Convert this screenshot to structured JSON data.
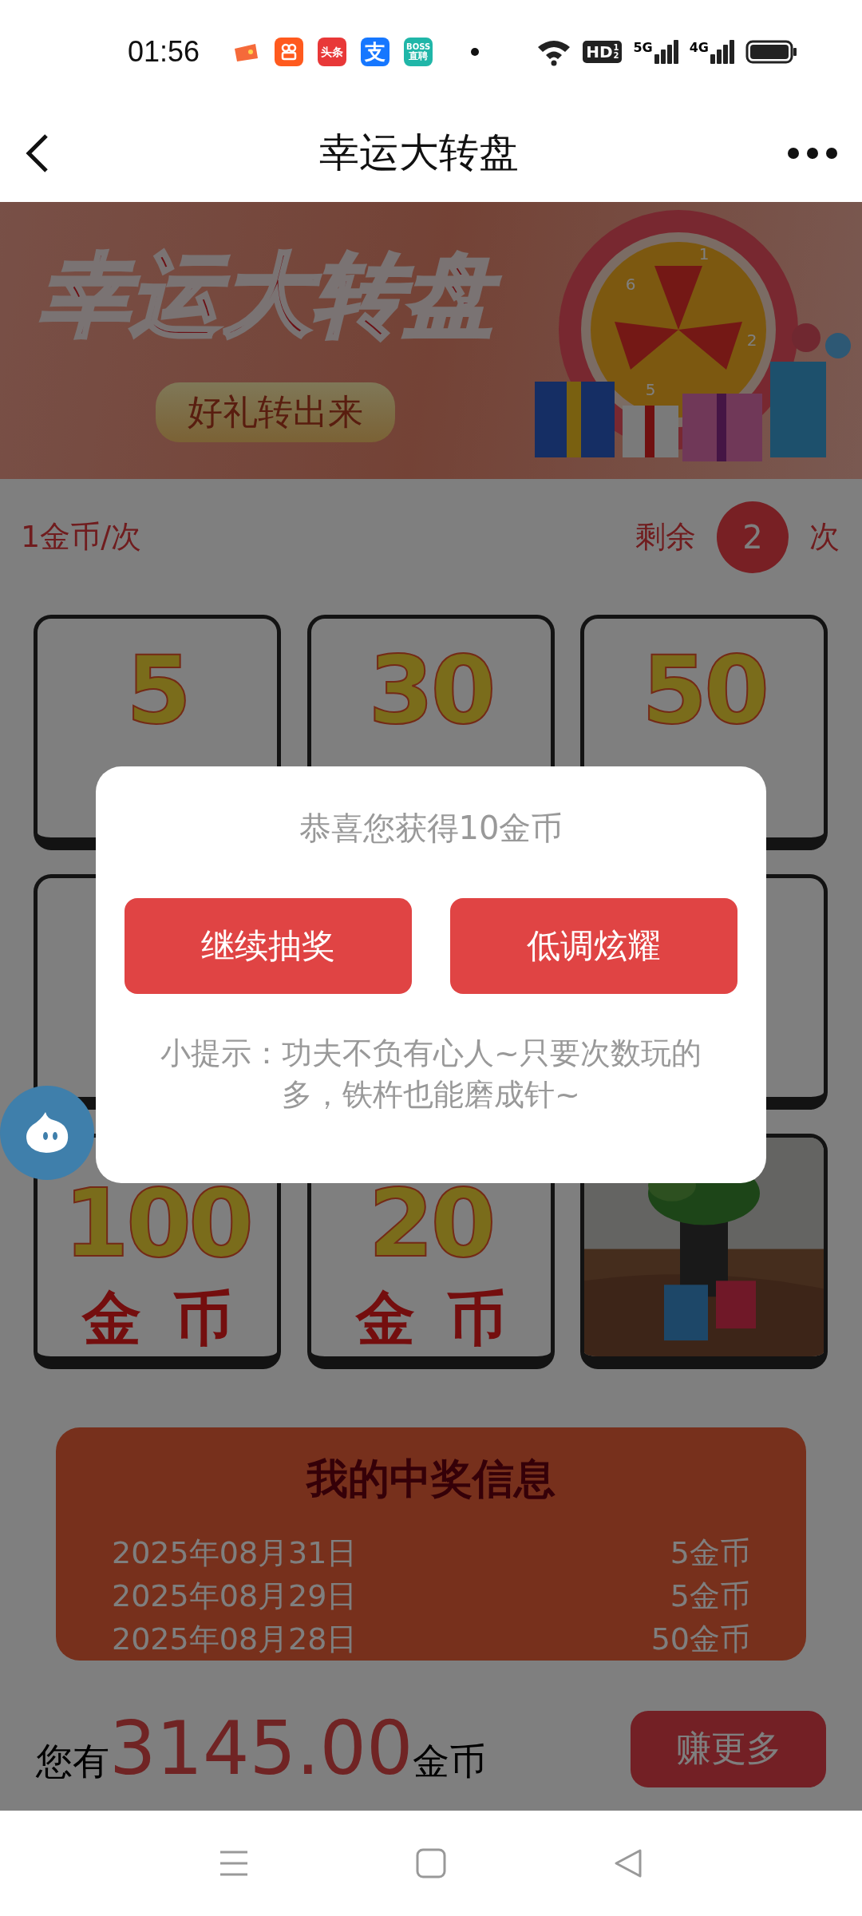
{
  "status_bar": {
    "time": "01:56",
    "app_icons": [
      {
        "kind": "game"
      },
      {
        "kind": "video"
      },
      {
        "kind": "news",
        "label": "头条"
      },
      {
        "kind": "pay",
        "label": "支"
      },
      {
        "kind": "jobs",
        "label": "BOSS",
        "sublabel": "直聘"
      }
    ],
    "hd": "HD",
    "hd_sub": [
      "1",
      "2"
    ],
    "signals": [
      "5G",
      "4G"
    ]
  },
  "nav": {
    "title": "幸运大转盘"
  },
  "banner": {
    "title": "幸运大转盘",
    "slogan": "好礼转出来",
    "wheel_labels": [
      "1",
      "2",
      "5",
      "6"
    ]
  },
  "info": {
    "cost": "1金币/次",
    "remaining_label": "剩余",
    "remaining_count": "2",
    "remaining_unit": "次"
  },
  "prize_rows": [
    [
      {
        "kind": "coins",
        "value": "5"
      },
      {
        "kind": "coins",
        "value": "30"
      },
      {
        "kind": "coins",
        "value": "50"
      }
    ],
    [
      {
        "kind": "coins"
      },
      {
        "kind": "coins"
      }
    ],
    [
      {
        "kind": "coins",
        "value": "100",
        "unit": "金币"
      },
      {
        "kind": "coins",
        "value": "20",
        "unit": "金币"
      },
      {
        "kind": "picture"
      }
    ]
  ],
  "dialog": {
    "message": "恭喜您获得10金币",
    "buttons": [
      "继续抽奖",
      "低调炫耀"
    ],
    "tip": "小提示：功夫不负有心人~只要次数玩的多，铁杵也能磨成针~"
  },
  "win_panel": {
    "title": "我的中奖信息",
    "rows": [
      {
        "date": "2025年08月31日",
        "prize": "5金币"
      },
      {
        "date": "2025年08月29日",
        "prize": "5金币"
      },
      {
        "date": "2025年08月28日",
        "prize": "50金币"
      }
    ]
  },
  "footer": {
    "prefix": "您有",
    "balance": "3145.00",
    "suffix": "金币",
    "button": "赚更多"
  }
}
